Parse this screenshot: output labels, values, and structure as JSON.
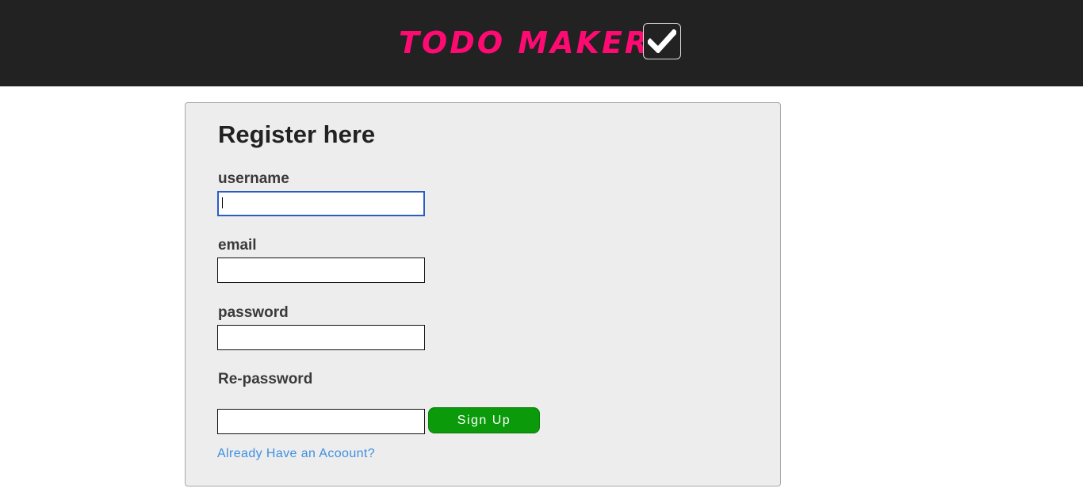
{
  "header": {
    "brand": "TODO MAKER",
    "logo_icon": "checkbox-checked-icon",
    "background": "#222222",
    "brand_color": "#ff0a72"
  },
  "form": {
    "title": "Register here",
    "fields": {
      "username": {
        "label": "username",
        "value": ""
      },
      "email": {
        "label": "email",
        "value": ""
      },
      "password": {
        "label": "password",
        "value": ""
      },
      "repassword": {
        "label": "Re-password",
        "value": ""
      }
    },
    "submit_label": "Sign Up",
    "submit_color": "#0a9a0a",
    "login_link": "Already Have an Acoount?",
    "link_color": "#3e8fe0",
    "card_background": "#ededed"
  }
}
